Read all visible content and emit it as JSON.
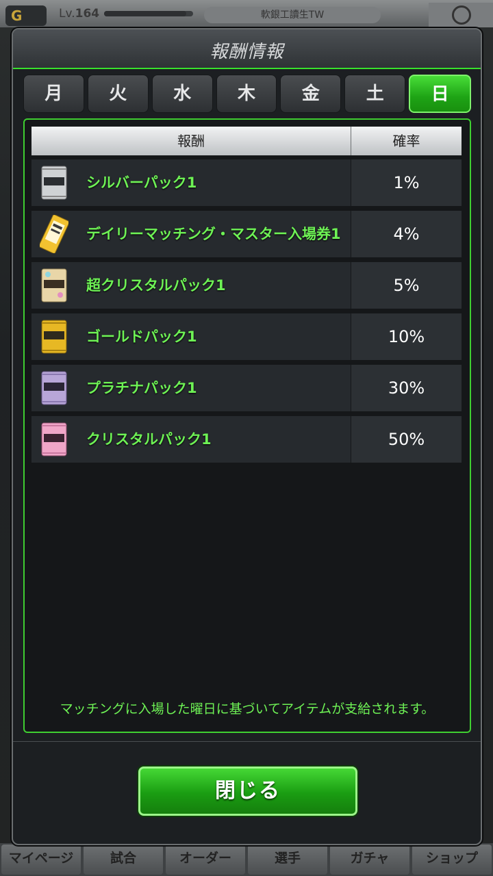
{
  "background": {
    "level_prefix": "Lv.",
    "level_value": "164",
    "user_name": "軟銀工讀生TW",
    "exp_progress": 0.92,
    "nav": [
      "マイページ",
      "試合",
      "オーダー",
      "選手",
      "ガチャ",
      "ショップ"
    ]
  },
  "modal": {
    "title": "報酬情報",
    "tabs": [
      "月",
      "火",
      "水",
      "木",
      "金",
      "土",
      "日"
    ],
    "active_tab": "日",
    "table": {
      "col_reward": "報酬",
      "col_rate": "確率",
      "rows": [
        {
          "name": "シルバーパック1",
          "rate": "1%",
          "icon": "silver-pack-icon",
          "color": "#cfd2d4"
        },
        {
          "name": "デイリーマッチング・マスター入場券1",
          "rate": "4%",
          "icon": "ticket-icon",
          "color": "#f2c230"
        },
        {
          "name": "超クリスタルパック1",
          "rate": "5%",
          "icon": "super-crystal-pack-icon",
          "color": "#e9d6a8"
        },
        {
          "name": "ゴールドパック1",
          "rate": "10%",
          "icon": "gold-pack-icon",
          "color": "#e7b824"
        },
        {
          "name": "プラチナパック1",
          "rate": "30%",
          "icon": "platinum-pack-icon",
          "color": "#b8a6d8"
        },
        {
          "name": "クリスタルパック1",
          "rate": "50%",
          "icon": "crystal-pack-icon",
          "color": "#f0a6c8"
        }
      ]
    },
    "note": "マッチングに入場した曜日に基づいてアイテムが支給されます。",
    "close_label": "閉じる"
  }
}
